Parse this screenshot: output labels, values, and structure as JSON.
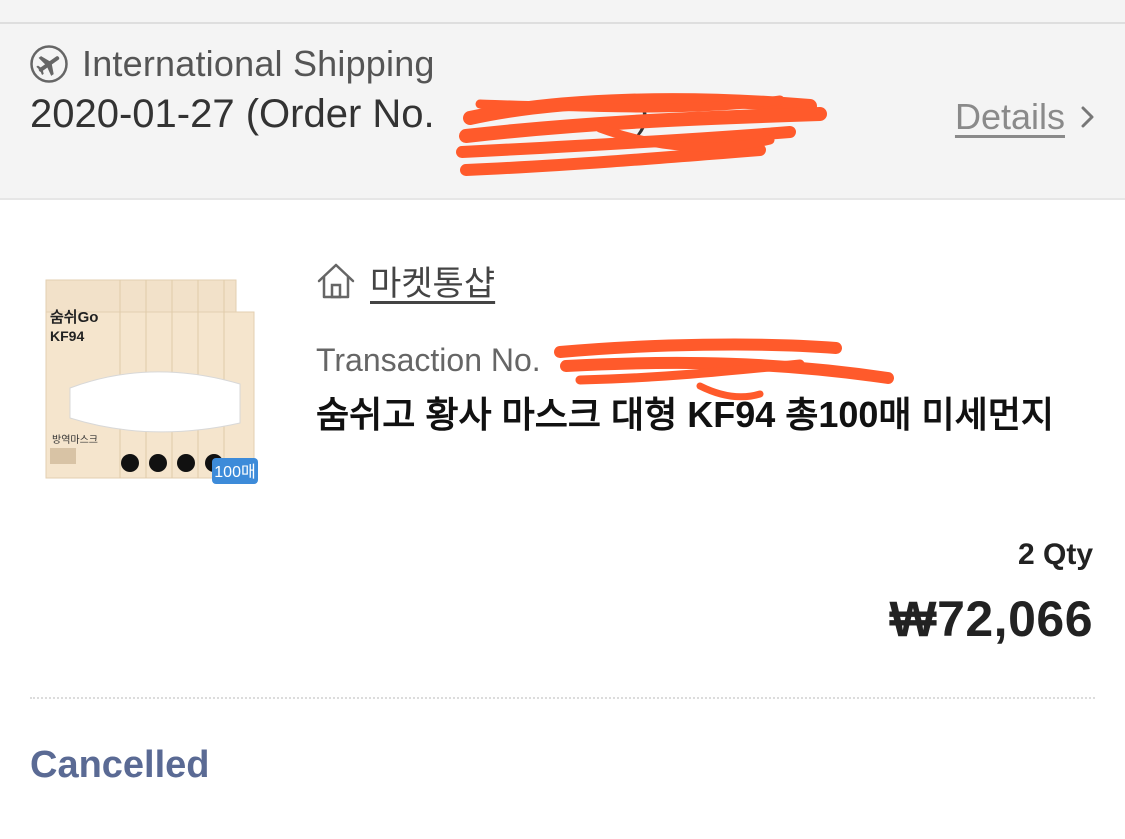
{
  "shipping": {
    "label": "International Shipping",
    "icon": "plane-icon"
  },
  "order": {
    "date": "2020-01-27",
    "prefix": "(Order No.",
    "number_redacted": "",
    "suffix": ")"
  },
  "details_link": {
    "label": "Details",
    "icon": "chevron-right-icon"
  },
  "product": {
    "seller_icon": "house-icon",
    "seller": "마켓통샵",
    "transaction_label": "Transaction No.",
    "title": "숨쉬고 황사 마스크 대형 KF94 총100매 미세먼지",
    "qty": "2 Qty",
    "price": "₩72,066"
  },
  "thumbnail": {
    "badge": "100매",
    "box_brand": "숨쉬Go",
    "box_grade": "KF94",
    "box_footer": "방역마스크"
  },
  "status": "Cancelled",
  "colors": {
    "header_bg": "#f4f4f4",
    "status": "#5a6a94",
    "redaction": "#ff5a2b",
    "badge": "#3d8bd9"
  }
}
